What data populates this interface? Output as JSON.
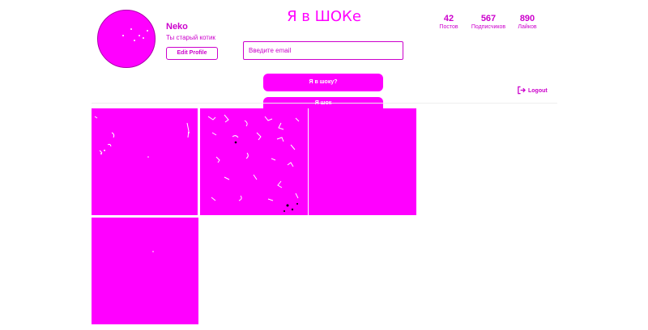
{
  "profile": {
    "username": "Neko",
    "bio": "Ты старый котик",
    "edit_label": "Edit Profile"
  },
  "brand": {
    "title": "Я в ШОКе"
  },
  "search": {
    "placeholder": "Введите email"
  },
  "stats": [
    {
      "value": "42",
      "label": "Постов"
    },
    {
      "value": "567",
      "label": "Подписчиков"
    },
    {
      "value": "890",
      "label": "Лайков"
    }
  ],
  "actions": {
    "primary_label": "Я в шоку?",
    "secondary_label": "Я шок"
  },
  "logout": {
    "label": "Logout",
    "icon": "logout-icon"
  },
  "theme": {
    "accent": "#ff00ff",
    "text": "#cc00cc",
    "background": "#ffffff"
  },
  "posts": [
    {
      "name": "post-1"
    },
    {
      "name": "post-2"
    },
    {
      "name": "post-3"
    },
    {
      "name": "post-4"
    }
  ]
}
